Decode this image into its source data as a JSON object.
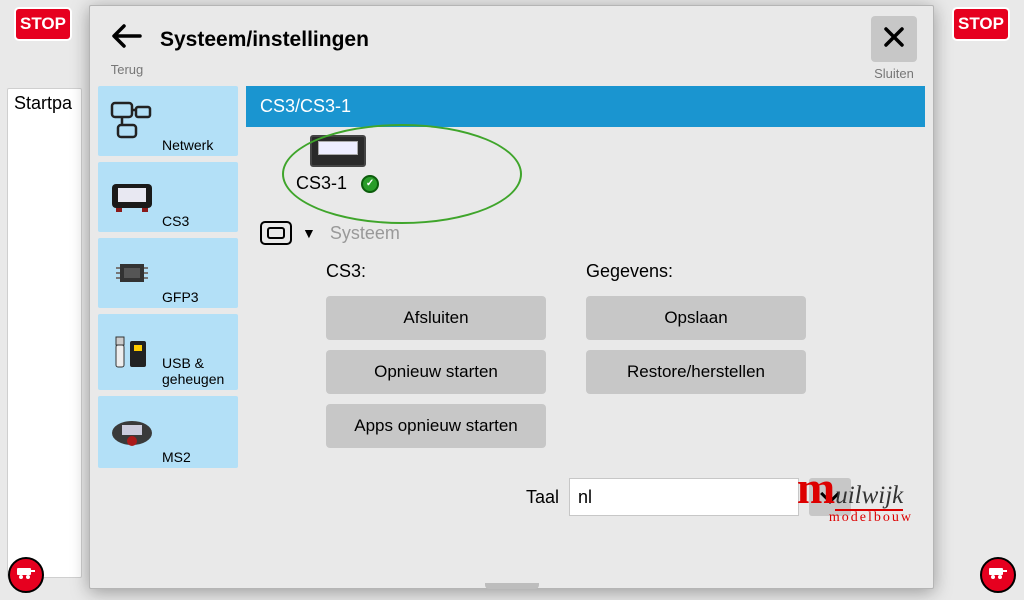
{
  "stop_label": "STOP",
  "background": {
    "start_tab": "Startpa"
  },
  "dialog": {
    "back_label": "Terug",
    "title": "Systeem/instellingen",
    "close_label": "Sluiten"
  },
  "sidebar": {
    "items": [
      {
        "label": "Netwerk"
      },
      {
        "label": "CS3"
      },
      {
        "label": "GFP3"
      },
      {
        "label": "USB & geheugen"
      },
      {
        "label": "MS2"
      }
    ]
  },
  "panel": {
    "title": "CS3/CS3-1",
    "device_name": "CS3-1",
    "section_label": "Systeem",
    "cs3_head": "CS3:",
    "data_head": "Gegevens:",
    "btn_shutdown": "Afsluiten",
    "btn_restart": "Opnieuw starten",
    "btn_apps_restart": "Apps opnieuw starten",
    "btn_save": "Opslaan",
    "btn_restore": "Restore/herstellen",
    "lang_label": "Taal",
    "lang_value": "nl"
  },
  "brand": {
    "m": "m",
    "rest": "uilwijk",
    "sub": "modelbouw"
  }
}
